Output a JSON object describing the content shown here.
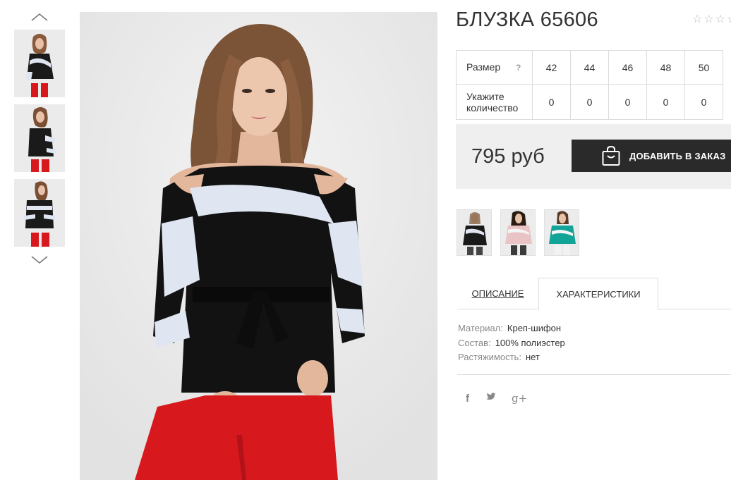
{
  "product": {
    "title": "БЛУЗКА 65606",
    "rating": {
      "stars_total": 5,
      "stars_filled": 0
    }
  },
  "gallery": {
    "thumbnails": [
      "view-front",
      "view-side",
      "view-back"
    ],
    "main_image": "model-front-view"
  },
  "size_table": {
    "size_label": "Размер",
    "help": "?",
    "quantity_label": "Укажите количество",
    "sizes": [
      "42",
      "44",
      "46",
      "48",
      "50"
    ],
    "quantities": [
      "0",
      "0",
      "0",
      "0",
      "0"
    ]
  },
  "order": {
    "price": "795 руб",
    "add_button_label": "ДОБАВИТЬ В ЗАКАЗ"
  },
  "colors": [
    {
      "name": "black-white",
      "accent": "#1c1c1c"
    },
    {
      "name": "pink",
      "accent": "#e9c3c6"
    },
    {
      "name": "turquoise",
      "accent": "#12a597"
    }
  ],
  "tabs": {
    "description": "ОПИСАНИЕ",
    "characteristics": "ХАРАКТЕРИСТИКИ",
    "active": "characteristics"
  },
  "specs": [
    {
      "key": "Материал:",
      "value": "Креп-шифон"
    },
    {
      "key": "Состав:",
      "value": "100% полиэстер"
    },
    {
      "key": "Растяжимость:",
      "value": "нет"
    }
  ],
  "share": {
    "facebook": "f",
    "twitter_icon": "twitter-icon",
    "googleplus": "g+"
  },
  "theme": {
    "button_bg": "#2a2a2a",
    "price_box_bg": "#efefef",
    "border": "#dcdcdc",
    "accent_red": "#d7191e"
  }
}
